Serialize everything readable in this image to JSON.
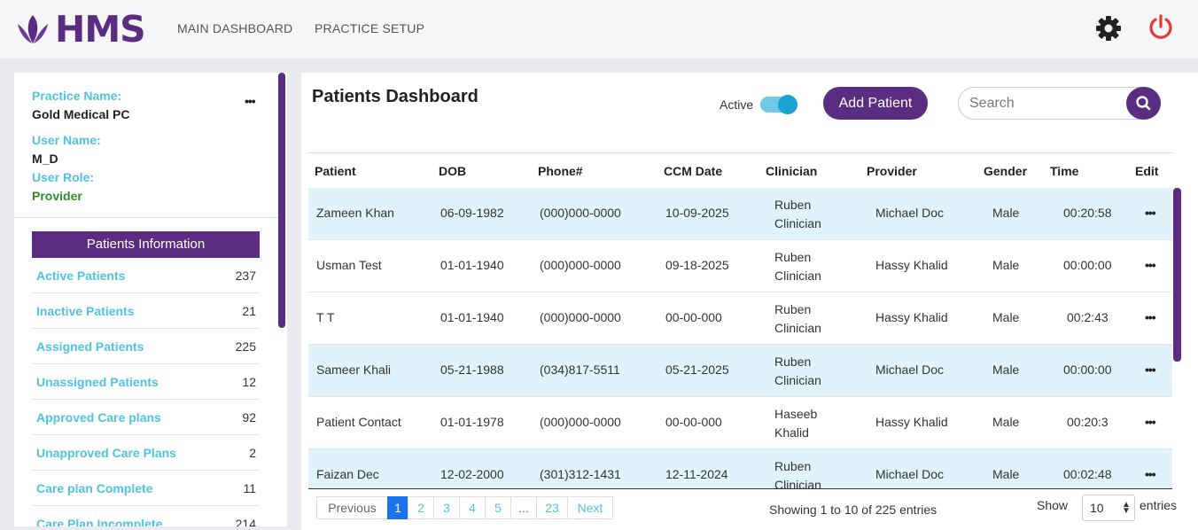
{
  "app": {
    "logo_text": "HMS"
  },
  "nav": {
    "main_dashboard": "MAIN DASHBOARD",
    "practice_setup": "PRACTICE SETUP"
  },
  "header_icons": [
    "gear-icon",
    "power-icon"
  ],
  "colors": {
    "brand": "#5b2d82",
    "accent_blue": "#4fc3e0",
    "power_red": "#e53935",
    "row_highlight": "#e0f3fb",
    "active_page": "#1a73e8"
  },
  "profile": {
    "practice_name_label": "Practice Name:",
    "practice_name": "Gold Medical PC",
    "user_name_label": "User Name:",
    "user_name": "M_D",
    "user_role_label": "User Role:",
    "user_role": "Provider"
  },
  "patients_info": {
    "header": "Patients Information",
    "items": [
      {
        "label": "Active Patients",
        "count": "237"
      },
      {
        "label": "Inactive Patients",
        "count": "21"
      },
      {
        "label": "Assigned Patients",
        "count": "225"
      },
      {
        "label": "Unassigned Patients",
        "count": "12"
      },
      {
        "label": "Approved Care plans",
        "count": "92"
      },
      {
        "label": "Unapproved Care Plans",
        "count": "2"
      },
      {
        "label": "Care plan Complete",
        "count": "11"
      },
      {
        "label": "Care Plan Incomplete",
        "count": "214"
      }
    ]
  },
  "dashboard": {
    "title": "Patients Dashboard",
    "active_label": "Active",
    "active_toggle_on": true,
    "add_patient_label": "Add Patient",
    "search_placeholder": "Search"
  },
  "table": {
    "columns": [
      "Patient",
      "DOB",
      "Phone#",
      "CCM Date",
      "Clinician",
      "Provider",
      "Gender",
      "Time",
      "Edit"
    ],
    "rows": [
      {
        "patient": "Zameen Khan",
        "dob": "06-09-1982",
        "phone": "(000)000-0000",
        "ccm_date": "10-09-2025",
        "clinician_1": "Ruben",
        "clinician_2": "Clinician",
        "provider": "Michael Doc",
        "gender": "Male",
        "time": "00:20:58",
        "highlight": true
      },
      {
        "patient": "Usman Test",
        "dob": "01-01-1940",
        "phone": "(000)000-0000",
        "ccm_date": "09-18-2025",
        "clinician_1": "Ruben",
        "clinician_2": "Clinician",
        "provider": "Hassy Khalid",
        "gender": "Male",
        "time": "00:00:00",
        "highlight": false
      },
      {
        "patient": "T T",
        "dob": "01-01-1940",
        "phone": "(000)000-0000",
        "ccm_date": "00-00-000",
        "clinician_1": "Ruben",
        "clinician_2": "Clinician",
        "provider": "Hassy Khalid",
        "gender": "Male",
        "time": "00:2:43",
        "highlight": false
      },
      {
        "patient": "Sameer Khali",
        "dob": "05-21-1988",
        "phone": "(034)817-5511",
        "ccm_date": "05-21-2025",
        "clinician_1": "Ruben",
        "clinician_2": "Clinician",
        "provider": "Michael Doc",
        "gender": "Male",
        "time": "00:00:00",
        "highlight": true
      },
      {
        "patient": "Patient Contact",
        "dob": "01-01-1978",
        "phone": "(000)000-0000",
        "ccm_date": "00-00-000",
        "clinician_1": "Haseeb",
        "clinician_2": "Khalid",
        "provider": "Hassy Khalid",
        "gender": "Male",
        "time": "00:20:3",
        "highlight": false
      },
      {
        "patient": "Faizan Dec",
        "dob": "12-02-2000",
        "phone": "(301)312-1431",
        "ccm_date": "12-11-2024",
        "clinician_1": "Ruben",
        "clinician_2": "Clinician",
        "provider": "Michael Doc",
        "gender": "Male",
        "time": "00:02:48",
        "highlight": true
      }
    ]
  },
  "pagination": {
    "previous": "Previous",
    "pages": [
      "1",
      "2",
      "3",
      "4",
      "5",
      "...",
      "23"
    ],
    "current": "1",
    "next": "Next",
    "showing": "Showing 1 to 10 of 225 entries",
    "show_label": "Show",
    "page_size": "10",
    "entries_label": "entries"
  }
}
